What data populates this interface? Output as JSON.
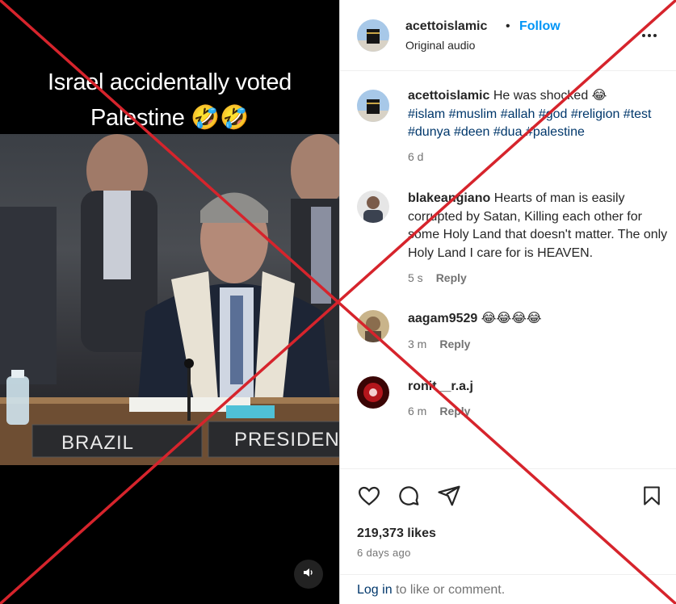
{
  "video": {
    "caption_line1": "Israel accidentally voted",
    "caption_line2": "Palestine 🤣🤣",
    "nameplate_left": "BRAZIL",
    "nameplate_right": "PRESIDEN",
    "sound_icon": "speaker-icon"
  },
  "header": {
    "username": "acettoislamic",
    "dot": "•",
    "follow_label": "Follow",
    "audio_label": "Original audio"
  },
  "comments": [
    {
      "username": "acettoislamic",
      "text": " He was shocked 😂",
      "tags": "#islam #muslim #allah #god #religion #test #dunya #deen #dua #palestine",
      "time": "6 d",
      "reply": ""
    },
    {
      "username": "blakeangiano",
      "text": " Hearts of man is easily corrupted by Satan, Killing each other for some Holy Land that doesn't matter. The only Holy Land I care for is HEAVEN.",
      "time": "5 s",
      "reply": "Reply"
    },
    {
      "username": "aagam9529",
      "text": " 😂😂😂😂",
      "time": "3 m",
      "reply": "Reply"
    },
    {
      "username": "ronit__r.a.j",
      "text": "",
      "time": "6 m",
      "reply": "Reply"
    }
  ],
  "actions": {
    "likes": "219,373 likes",
    "ago": "6 days ago",
    "login_link": "Log in",
    "login_rest": " to like or comment.",
    "icons": [
      "heart-icon",
      "comment-icon",
      "share-icon",
      "bookmark-icon"
    ]
  },
  "colors": {
    "accent": "#0095f6",
    "cross": "#d6242c",
    "tag": "#00376b"
  }
}
